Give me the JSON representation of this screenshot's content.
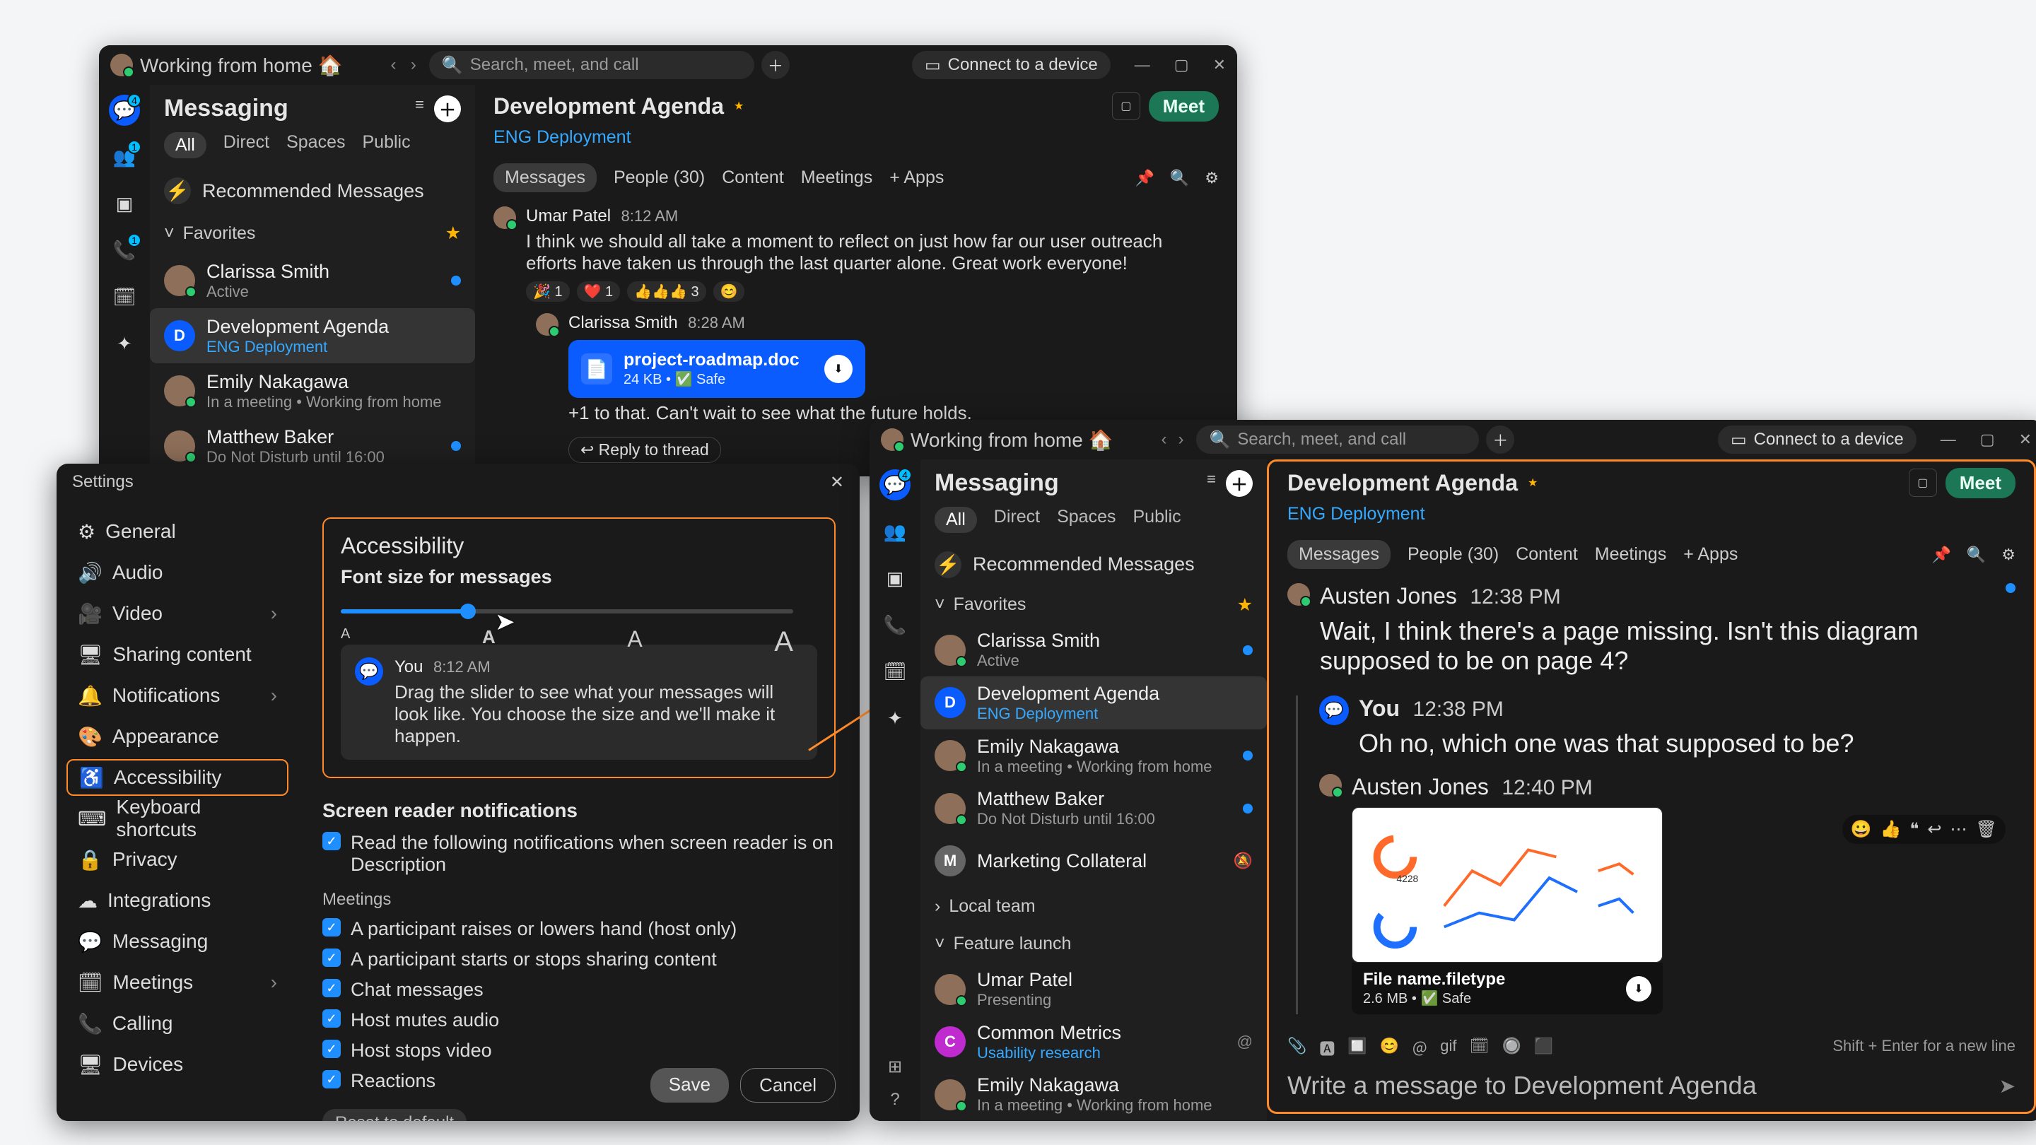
{
  "presence": "Working from home 🏠",
  "search_placeholder": "Search, meet, and call",
  "connect": "Connect to a device",
  "rail_badges": {
    "chat": "4",
    "teams": "1",
    "calls": "1"
  },
  "list": {
    "header": "Messaging",
    "filters": [
      "All",
      "Direct",
      "Spaces",
      "Public"
    ],
    "recommended": "Recommended Messages",
    "favorites_label": "Favorites",
    "favorites": [
      {
        "name": "Clarissa Smith",
        "sub": "Active"
      },
      {
        "name": "Development Agenda",
        "sub": "ENG Deployment",
        "sublink": true,
        "letter": "D",
        "selected": true
      },
      {
        "name": "Emily Nakagawa",
        "sub": "In a meeting  •  Working from home"
      },
      {
        "name": "Matthew Baker",
        "sub": "Do Not Disturb until 16:00"
      }
    ]
  },
  "list2_extra": {
    "marketing": {
      "name": "Marketing Collateral",
      "letter": "M"
    },
    "local_team": "Local team",
    "feature_launch": "Feature launch",
    "items": [
      {
        "name": "Umar Patel",
        "sub": "Presenting"
      },
      {
        "name": "Common Metrics",
        "sub": "Usability research",
        "sublink": true,
        "letter": "C",
        "purple": true
      },
      {
        "name": "Emily Nakagawa",
        "sub": "In a meeting  •  Working from home"
      }
    ]
  },
  "chat": {
    "title": "Development Agenda",
    "space": "ENG Deployment",
    "tabs": [
      "Messages",
      "People (30)",
      "Content",
      "Meetings",
      "+  Apps"
    ],
    "meet": "Meet",
    "msg1": {
      "name": "Umar Patel",
      "time": "8:12 AM",
      "text": "I think we should all take a moment to reflect on just how far our user outreach efforts have taken us through the last quarter alone. Great work everyone!",
      "reactions": [
        "🎉 1",
        "❤️ 1",
        "👍👍👍 3",
        "😊"
      ]
    },
    "reply": {
      "name": "Clarissa Smith",
      "time": "8:28 AM",
      "file": {
        "name": "project-roadmap.doc",
        "meta": "24 KB   •   ✅ Safe"
      },
      "text": "+1 to that. Can't wait to see what the future holds.",
      "cta": "↩ Reply to thread"
    }
  },
  "chat2": {
    "m1": {
      "name": "Austen Jones",
      "time": "12:38 PM",
      "text": "Wait, I think there's a page missing. Isn't this diagram supposed to be on page 4?"
    },
    "you": {
      "label": "You",
      "time": "12:38 PM",
      "text": "Oh no, which one was that supposed to be?"
    },
    "m2": {
      "name": "Austen Jones",
      "time": "12:40 PM"
    },
    "image": {
      "name": "File name.filetype",
      "meta": "2.6 MB   •   ✅ Safe"
    },
    "react_bar": [
      "😀",
      "👍",
      "❝",
      "↩",
      "⋯",
      "🗑"
    ],
    "composer": {
      "icons": [
        "📎",
        "🅰",
        "🔲",
        "😊",
        "＠",
        "gif",
        "🗓",
        "🔘",
        "⬛"
      ],
      "hint": "Shift + Enter for a new line",
      "placeholder": "Write a message to Development Agenda"
    }
  },
  "settings": {
    "title": "Settings",
    "nav": [
      {
        "icon": "⚙",
        "label": "General"
      },
      {
        "icon": "🔊",
        "label": "Audio"
      },
      {
        "icon": "🎥",
        "label": "Video",
        "sub": true
      },
      {
        "icon": "🖥",
        "label": "Sharing content"
      },
      {
        "icon": "🔔",
        "label": "Notifications",
        "sub": true
      },
      {
        "icon": "🎨",
        "label": "Appearance"
      },
      {
        "icon": "♿",
        "label": "Accessibility",
        "selected": true
      },
      {
        "icon": "⌨",
        "label": "Keyboard shortcuts"
      },
      {
        "icon": "🔒",
        "label": "Privacy"
      },
      {
        "icon": "☁",
        "label": "Integrations"
      },
      {
        "icon": "💬",
        "label": "Messaging"
      },
      {
        "icon": "🗓",
        "label": "Meetings",
        "sub": true
      },
      {
        "icon": "📞",
        "label": "Calling"
      },
      {
        "icon": "🖥",
        "label": "Devices"
      }
    ],
    "panel": {
      "title": "Accessibility",
      "font_label": "Font size for messages",
      "preview": {
        "name": "You",
        "time": "8:12 AM",
        "text": "Drag the slider to see what your messages will look like. You choose the size and we'll make it happen."
      },
      "sr_title": "Screen reader notifications",
      "sr_desc": "Read the following notifications when screen reader is on Description",
      "meetings_label": "Meetings",
      "checks": [
        "A participant raises or lowers hand (host only)",
        "A participant starts or stops sharing content",
        "Chat messages",
        "Host mutes audio",
        "Host stops video",
        "Reactions"
      ],
      "reset": "Reset to default",
      "save": "Save",
      "cancel": "Cancel"
    }
  }
}
